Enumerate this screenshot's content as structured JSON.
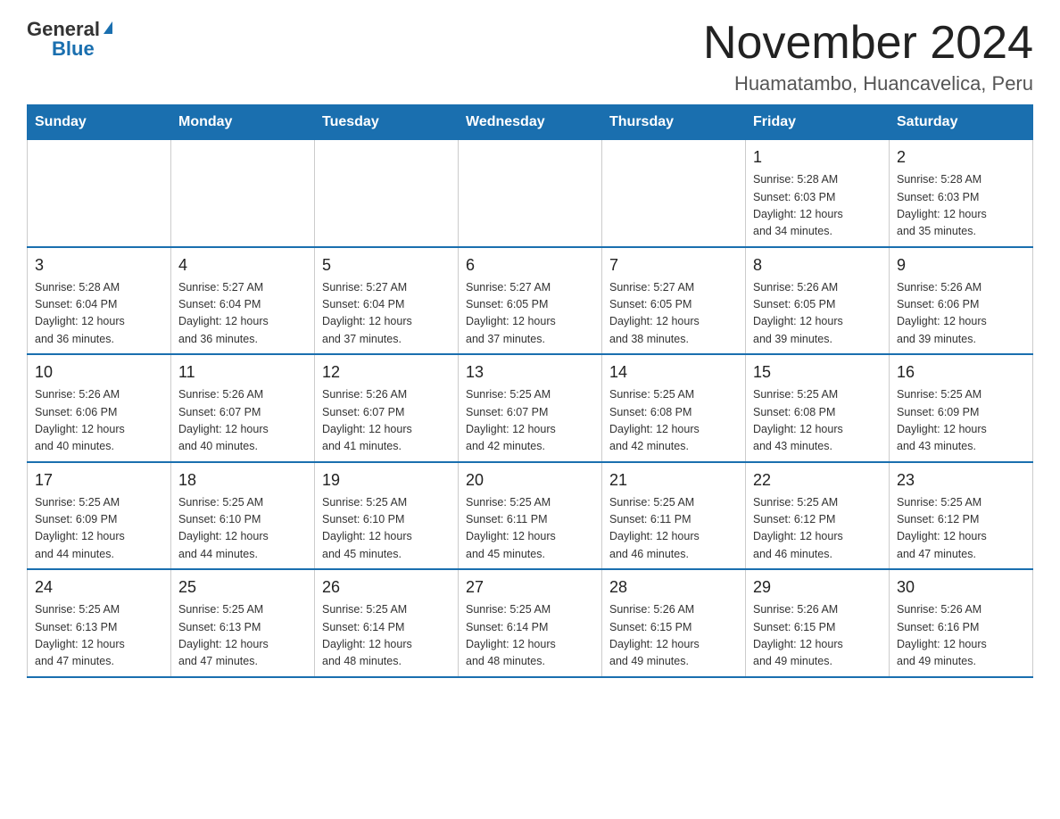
{
  "header": {
    "logo": {
      "general": "General",
      "blue": "Blue"
    },
    "title": "November 2024",
    "subtitle": "Huamatambo, Huancavelica, Peru"
  },
  "weekdays": [
    "Sunday",
    "Monday",
    "Tuesday",
    "Wednesday",
    "Thursday",
    "Friday",
    "Saturday"
  ],
  "weeks": [
    [
      {
        "day": "",
        "info": ""
      },
      {
        "day": "",
        "info": ""
      },
      {
        "day": "",
        "info": ""
      },
      {
        "day": "",
        "info": ""
      },
      {
        "day": "",
        "info": ""
      },
      {
        "day": "1",
        "info": "Sunrise: 5:28 AM\nSunset: 6:03 PM\nDaylight: 12 hours\nand 34 minutes."
      },
      {
        "day": "2",
        "info": "Sunrise: 5:28 AM\nSunset: 6:03 PM\nDaylight: 12 hours\nand 35 minutes."
      }
    ],
    [
      {
        "day": "3",
        "info": "Sunrise: 5:28 AM\nSunset: 6:04 PM\nDaylight: 12 hours\nand 36 minutes."
      },
      {
        "day": "4",
        "info": "Sunrise: 5:27 AM\nSunset: 6:04 PM\nDaylight: 12 hours\nand 36 minutes."
      },
      {
        "day": "5",
        "info": "Sunrise: 5:27 AM\nSunset: 6:04 PM\nDaylight: 12 hours\nand 37 minutes."
      },
      {
        "day": "6",
        "info": "Sunrise: 5:27 AM\nSunset: 6:05 PM\nDaylight: 12 hours\nand 37 minutes."
      },
      {
        "day": "7",
        "info": "Sunrise: 5:27 AM\nSunset: 6:05 PM\nDaylight: 12 hours\nand 38 minutes."
      },
      {
        "day": "8",
        "info": "Sunrise: 5:26 AM\nSunset: 6:05 PM\nDaylight: 12 hours\nand 39 minutes."
      },
      {
        "day": "9",
        "info": "Sunrise: 5:26 AM\nSunset: 6:06 PM\nDaylight: 12 hours\nand 39 minutes."
      }
    ],
    [
      {
        "day": "10",
        "info": "Sunrise: 5:26 AM\nSunset: 6:06 PM\nDaylight: 12 hours\nand 40 minutes."
      },
      {
        "day": "11",
        "info": "Sunrise: 5:26 AM\nSunset: 6:07 PM\nDaylight: 12 hours\nand 40 minutes."
      },
      {
        "day": "12",
        "info": "Sunrise: 5:26 AM\nSunset: 6:07 PM\nDaylight: 12 hours\nand 41 minutes."
      },
      {
        "day": "13",
        "info": "Sunrise: 5:25 AM\nSunset: 6:07 PM\nDaylight: 12 hours\nand 42 minutes."
      },
      {
        "day": "14",
        "info": "Sunrise: 5:25 AM\nSunset: 6:08 PM\nDaylight: 12 hours\nand 42 minutes."
      },
      {
        "day": "15",
        "info": "Sunrise: 5:25 AM\nSunset: 6:08 PM\nDaylight: 12 hours\nand 43 minutes."
      },
      {
        "day": "16",
        "info": "Sunrise: 5:25 AM\nSunset: 6:09 PM\nDaylight: 12 hours\nand 43 minutes."
      }
    ],
    [
      {
        "day": "17",
        "info": "Sunrise: 5:25 AM\nSunset: 6:09 PM\nDaylight: 12 hours\nand 44 minutes."
      },
      {
        "day": "18",
        "info": "Sunrise: 5:25 AM\nSunset: 6:10 PM\nDaylight: 12 hours\nand 44 minutes."
      },
      {
        "day": "19",
        "info": "Sunrise: 5:25 AM\nSunset: 6:10 PM\nDaylight: 12 hours\nand 45 minutes."
      },
      {
        "day": "20",
        "info": "Sunrise: 5:25 AM\nSunset: 6:11 PM\nDaylight: 12 hours\nand 45 minutes."
      },
      {
        "day": "21",
        "info": "Sunrise: 5:25 AM\nSunset: 6:11 PM\nDaylight: 12 hours\nand 46 minutes."
      },
      {
        "day": "22",
        "info": "Sunrise: 5:25 AM\nSunset: 6:12 PM\nDaylight: 12 hours\nand 46 minutes."
      },
      {
        "day": "23",
        "info": "Sunrise: 5:25 AM\nSunset: 6:12 PM\nDaylight: 12 hours\nand 47 minutes."
      }
    ],
    [
      {
        "day": "24",
        "info": "Sunrise: 5:25 AM\nSunset: 6:13 PM\nDaylight: 12 hours\nand 47 minutes."
      },
      {
        "day": "25",
        "info": "Sunrise: 5:25 AM\nSunset: 6:13 PM\nDaylight: 12 hours\nand 47 minutes."
      },
      {
        "day": "26",
        "info": "Sunrise: 5:25 AM\nSunset: 6:14 PM\nDaylight: 12 hours\nand 48 minutes."
      },
      {
        "day": "27",
        "info": "Sunrise: 5:25 AM\nSunset: 6:14 PM\nDaylight: 12 hours\nand 48 minutes."
      },
      {
        "day": "28",
        "info": "Sunrise: 5:26 AM\nSunset: 6:15 PM\nDaylight: 12 hours\nand 49 minutes."
      },
      {
        "day": "29",
        "info": "Sunrise: 5:26 AM\nSunset: 6:15 PM\nDaylight: 12 hours\nand 49 minutes."
      },
      {
        "day": "30",
        "info": "Sunrise: 5:26 AM\nSunset: 6:16 PM\nDaylight: 12 hours\nand 49 minutes."
      }
    ]
  ]
}
